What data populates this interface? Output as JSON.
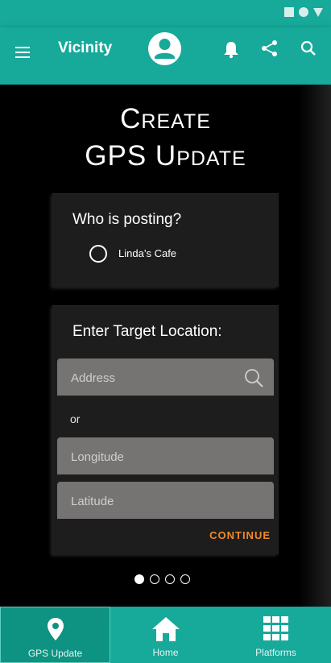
{
  "app": {
    "title": "Vicinity"
  },
  "page": {
    "title_line1": "Create",
    "title_line2": "GPS Update"
  },
  "poster_card": {
    "heading": "Who is posting?",
    "option_label": "Linda’s Cafe"
  },
  "location_card": {
    "heading": "Enter Target Location:",
    "address_placeholder": "Address",
    "or_text": "or",
    "longitude_placeholder": "Longitude",
    "latitude_placeholder": "Latitude",
    "continue_label": "CONTINUE"
  },
  "pager": {
    "total": 4,
    "active_index": 0
  },
  "bottom_nav": {
    "items": [
      {
        "label": "GPS Update",
        "icon": "location-pin-icon",
        "active": true
      },
      {
        "label": "Home",
        "icon": "home-icon",
        "active": false
      },
      {
        "label": "Platforms",
        "icon": "grid-icon",
        "active": false
      }
    ]
  },
  "colors": {
    "primary": "#17a99a",
    "accent": "#ef8a2a",
    "card": "#1d1d1d",
    "field": "#767473"
  }
}
